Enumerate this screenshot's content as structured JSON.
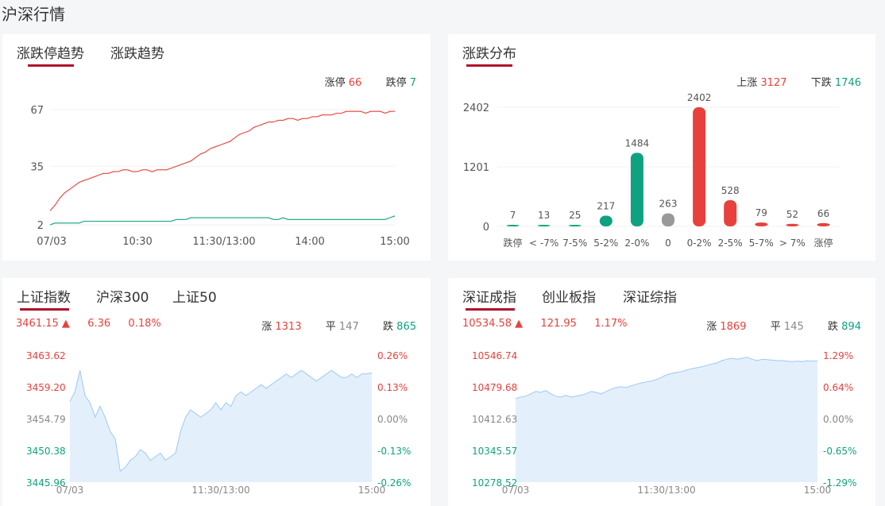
{
  "page": {
    "title": "沪深行情"
  },
  "trend": {
    "tabs": [
      "涨跌停趋势",
      "涨跌趋势"
    ],
    "limit_up_label": "涨停",
    "limit_up_value": "66",
    "limit_down_label": "跌停",
    "limit_down_value": "7",
    "colors": {
      "up": "#e8413c",
      "down": "#0fa281"
    }
  },
  "distribution": {
    "tabs": [
      "涨跌分布"
    ],
    "rise_label": "上涨",
    "rise_value": "3127",
    "fall_label": "下跌",
    "fall_value": "1746"
  },
  "sh_index": {
    "tabs": [
      "上证指数",
      "沪深300",
      "上证50"
    ],
    "price": "3461.15",
    "change": "6.36",
    "change_pct": "0.18%",
    "up_label": "涨",
    "up_count": "1313",
    "flat_label": "平",
    "flat_count": "147",
    "down_label": "跌",
    "down_count": "865"
  },
  "sz_index": {
    "tabs": [
      "深证成指",
      "创业板指",
      "深证综指"
    ],
    "price": "10534.58",
    "change": "121.95",
    "change_pct": "1.17%",
    "up_label": "涨",
    "up_count": "1869",
    "flat_label": "平",
    "flat_count": "145",
    "down_label": "跌",
    "down_count": "894"
  },
  "chart_data": [
    {
      "type": "line",
      "x_ticks": [
        "07/03",
        "10:30",
        "11:30/13:00",
        "14:00",
        "15:00"
      ],
      "y_ticks": [
        "67",
        "35",
        "2"
      ],
      "ylim": [
        2,
        67
      ],
      "series": [
        {
          "name": "涨停",
          "color": "#e8413c",
          "values": [
            10,
            13,
            17,
            20,
            22,
            24,
            26,
            27,
            28,
            29,
            30,
            31,
            31,
            32,
            32,
            33,
            33,
            32,
            32,
            33,
            33,
            32,
            33,
            33,
            33,
            34,
            35,
            36,
            37,
            38,
            40,
            42,
            43,
            45,
            46,
            47,
            48,
            49,
            51,
            53,
            54,
            55,
            57,
            58,
            59,
            60,
            60,
            61,
            61,
            62,
            62,
            61,
            62,
            62,
            63,
            63,
            64,
            64,
            64,
            65,
            65,
            66,
            66,
            66,
            66,
            65,
            66,
            66,
            66,
            65,
            66,
            66
          ]
        },
        {
          "name": "跌停",
          "color": "#0fa281",
          "values": [
            2,
            3,
            3,
            3,
            3,
            3,
            3,
            4,
            4,
            4,
            4,
            4,
            4,
            4,
            4,
            4,
            4,
            4,
            4,
            4,
            4,
            4,
            4,
            4,
            4,
            4,
            5,
            5,
            5,
            6,
            6,
            6,
            6,
            6,
            6,
            6,
            6,
            6,
            6,
            6,
            6,
            6,
            6,
            6,
            6,
            6,
            5,
            5,
            6,
            5,
            5,
            5,
            5,
            5,
            5,
            5,
            5,
            5,
            5,
            5,
            5,
            5,
            5,
            5,
            5,
            5,
            5,
            5,
            5,
            5,
            6,
            7
          ]
        }
      ]
    },
    {
      "type": "bar",
      "categories": [
        "跌停",
        "< -7%",
        "7-5%",
        "5-2%",
        "2-0%",
        "0",
        "0-2%",
        "2-5%",
        "5-7%",
        "> 7%",
        "涨停"
      ],
      "values": [
        7,
        13,
        25,
        217,
        1484,
        263,
        2402,
        528,
        79,
        52,
        66
      ],
      "colors": [
        "#0fa281",
        "#0fa281",
        "#0fa281",
        "#0fa281",
        "#0fa281",
        "#999999",
        "#e8413c",
        "#e8413c",
        "#e8413c",
        "#e8413c",
        "#e8413c"
      ],
      "y_ticks": [
        "2402",
        "1201",
        "0"
      ],
      "ylim": [
        0,
        2402
      ]
    },
    {
      "type": "area",
      "x_ticks": [
        "07/03",
        "11:30/13:00",
        "15:00"
      ],
      "y_left": [
        "3463.62",
        "3459.20",
        "3454.79",
        "3450.38",
        "3445.96"
      ],
      "y_right": [
        "0.26%",
        "0.13%",
        "0.00%",
        "-0.13%",
        "-0.26%"
      ],
      "ylim": [
        3445.96,
        3463.62
      ],
      "values": [
        3457.2,
        3458.5,
        3461.5,
        3458.0,
        3457.0,
        3455.0,
        3456.5,
        3455.0,
        3453.0,
        3452.0,
        3447.5,
        3448.0,
        3449.0,
        3449.5,
        3450.5,
        3450.0,
        3449.0,
        3449.5,
        3450.0,
        3449.0,
        3449.5,
        3450.0,
        3453.0,
        3455.0,
        3456.0,
        3455.5,
        3455.0,
        3455.5,
        3456.0,
        3457.0,
        3456.0,
        3457.0,
        3456.5,
        3458.0,
        3458.5,
        3458.0,
        3458.5,
        3459.0,
        3459.5,
        3459.0,
        3459.5,
        3460.0,
        3460.5,
        3461.0,
        3460.5,
        3461.0,
        3461.5,
        3461.0,
        3460.5,
        3460.0,
        3460.5,
        3461.0,
        3461.5,
        3461.0,
        3460.5,
        3460.5,
        3461.0,
        3460.5,
        3461.0,
        3461.0,
        3461.15
      ]
    },
    {
      "type": "area",
      "x_ticks": [
        "07/03",
        "11:30/13:00",
        "15:00"
      ],
      "y_left": [
        "10546.74",
        "10479.68",
        "10412.63",
        "10345.57",
        "10278.52"
      ],
      "y_right": [
        "1.29%",
        "0.64%",
        "0.00%",
        "-0.65%",
        "-1.29%"
      ],
      "ylim": [
        10278.52,
        10546.74
      ],
      "values": [
        10455,
        10458,
        10460,
        10465,
        10470,
        10468,
        10472,
        10465,
        10460,
        10458,
        10462,
        10458,
        10460,
        10462,
        10465,
        10470,
        10468,
        10465,
        10470,
        10475,
        10478,
        10480,
        10478,
        10482,
        10485,
        10488,
        10490,
        10492,
        10495,
        10500,
        10505,
        10508,
        10510,
        10512,
        10515,
        10518,
        10520,
        10522,
        10525,
        10528,
        10530,
        10535,
        10538,
        10540,
        10538,
        10540,
        10542,
        10538,
        10535,
        10538,
        10537,
        10536,
        10535,
        10535,
        10534,
        10533,
        10534,
        10533,
        10535,
        10534,
        10534.58
      ]
    }
  ]
}
